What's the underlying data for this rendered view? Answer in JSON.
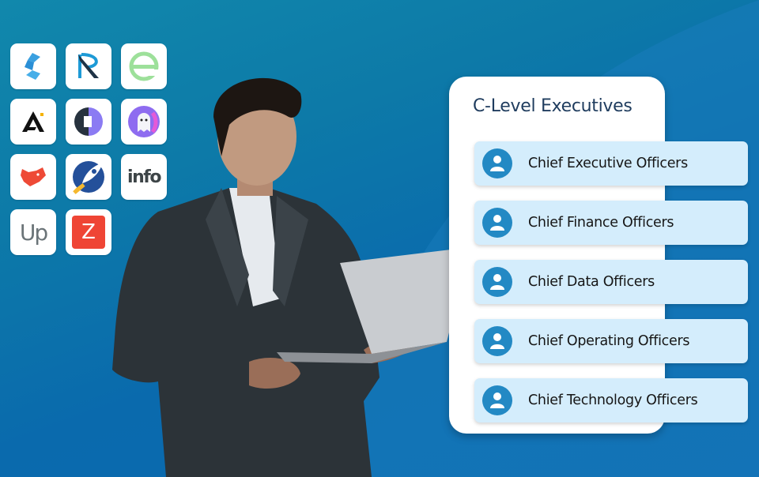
{
  "colors": {
    "background": "#0c74ab",
    "card": "#ffffff",
    "role_pill": "#d4edfc",
    "avatar": "#2389c4",
    "title": "#1f3c5e"
  },
  "logos": [
    {
      "name": "blue-blocks-logo"
    },
    {
      "name": "r-logo"
    },
    {
      "name": "green-e-logo"
    },
    {
      "name": "a-arrow-logo"
    },
    {
      "name": "c-half-logo"
    },
    {
      "name": "ghost-logo"
    },
    {
      "name": "fox-logo"
    },
    {
      "name": "rocket-logo"
    },
    {
      "name": "info-logo",
      "text": "info"
    },
    {
      "name": "up-logo",
      "text": "Up"
    },
    {
      "name": "z-logo",
      "text": "Z"
    }
  ],
  "card": {
    "title": "C-Level Executives",
    "roles": [
      {
        "label": "Chief Executive Officers",
        "icon": "user-icon"
      },
      {
        "label": "Chief Finance Officers",
        "icon": "user-icon"
      },
      {
        "label": "Chief Data Officers",
        "icon": "user-icon"
      },
      {
        "label": "Chief Operating Officers",
        "icon": "user-icon"
      },
      {
        "label": "Chief Technology Officers",
        "icon": "user-icon"
      }
    ]
  }
}
